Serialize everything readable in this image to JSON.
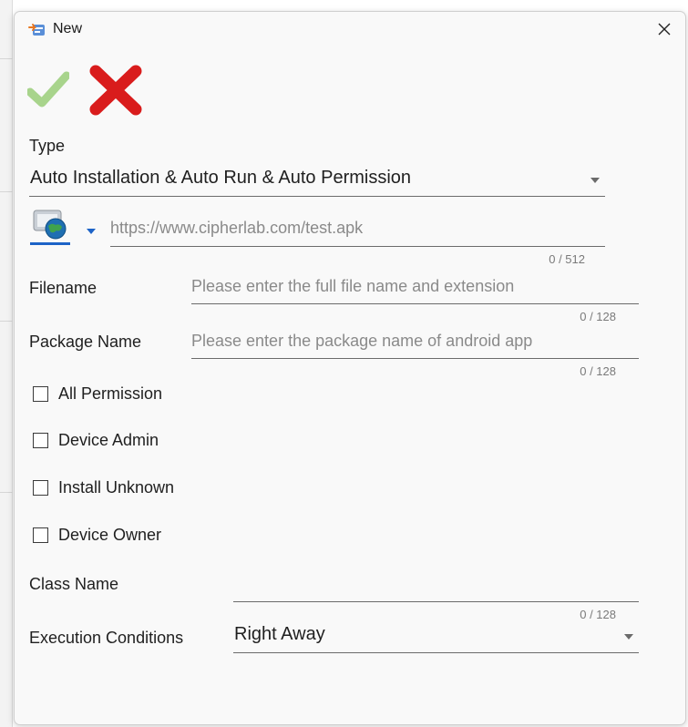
{
  "dialog": {
    "title": "New",
    "close_glyph": "✕"
  },
  "toolbar": {
    "ok_icon": "checkmark-icon",
    "cancel_icon": "cross-icon",
    "ok_color": "#a8d48c",
    "cancel_color": "#d91c1c"
  },
  "form": {
    "type_label": "Type",
    "type_value": "Auto Installation & Auto Run & Auto Permission",
    "url_placeholder": "https://www.cipherlab.com/test.apk",
    "url_counter": "0 / 512",
    "filename_label": "Filename",
    "filename_placeholder": "Please enter the full file name and extension",
    "filename_counter": "0 / 128",
    "package_label": "Package Name",
    "package_placeholder": "Please enter the package name of android app",
    "package_counter": "0 / 128",
    "checkboxes": [
      {
        "label": "All Permission",
        "checked": false
      },
      {
        "label": "Device Admin",
        "checked": false
      },
      {
        "label": "Install Unknown",
        "checked": false
      },
      {
        "label": "Device Owner",
        "checked": false
      }
    ],
    "class_label": "Class Name",
    "class_counter": "0 / 128",
    "exec_label": "Execution Conditions",
    "exec_value": "Right Away"
  },
  "accent_color": "#1d63c7"
}
